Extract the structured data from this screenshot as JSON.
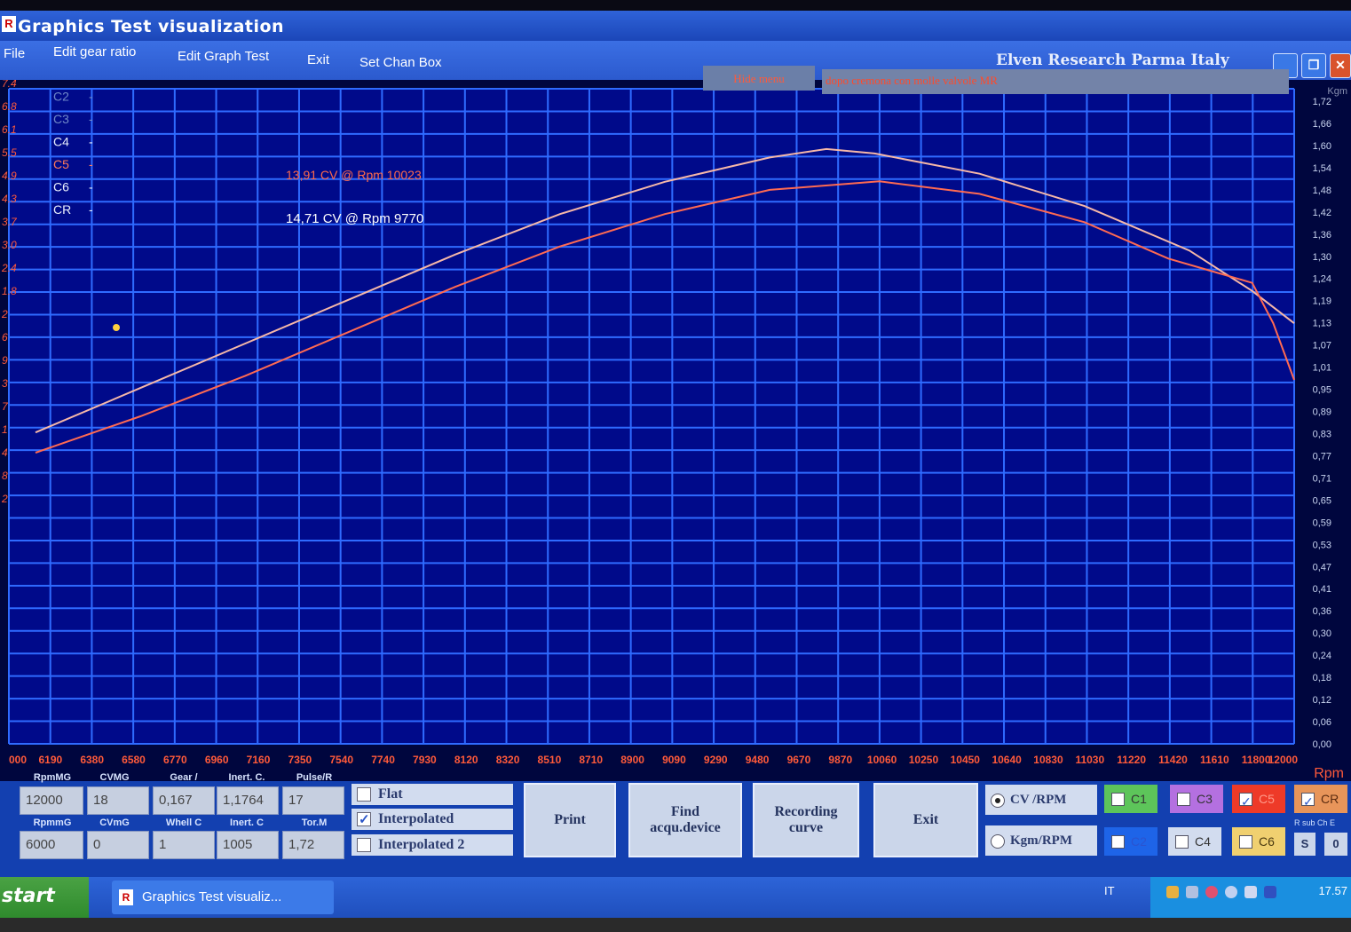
{
  "window": {
    "title": "Graphics Test visualization"
  },
  "menu": {
    "items": [
      "File",
      "Edit gear ratio",
      "Edit Graph Test",
      "Exit",
      "Set Chan Box"
    ],
    "brand": "Elven Research Parma Italy",
    "hide_menu": "Hide menu",
    "notes": "dopo cremona con molle valvole MR"
  },
  "colors": {
    "background": "#000a8a",
    "grid": "#2f6bff",
    "curve_light": "#f6b8a8",
    "curve_dark": "#ff6a52",
    "accent_red": "#ff5a3a"
  },
  "readout": {
    "channels": [
      "C1",
      "C2",
      "C3",
      "C4",
      "C5",
      "C6",
      "CR"
    ],
    "c5_value": "13,91 CV @ Rpm  10023",
    "cr_value": "14,71 CV @ Rpm  9770"
  },
  "chart_data": {
    "type": "line",
    "x_tick_labels": [
      "000",
      "6190",
      "6380",
      "6580",
      "6770",
      "6960",
      "7160",
      "7350",
      "7540",
      "7740",
      "7930",
      "8120",
      "8320",
      "8510",
      "8710",
      "8900",
      "9090",
      "9290",
      "9480",
      "9670",
      "9870",
      "10060",
      "10250",
      "10450",
      "10640",
      "10830",
      "11030",
      "11220",
      "11420",
      "11610",
      "11800",
      "12000"
    ],
    "right_tick_labels": [
      "1,72",
      "1,66",
      "1,60",
      "1,54",
      "1,48",
      "1,42",
      "1,36",
      "1,30",
      "1,24",
      "1,19",
      "1,13",
      "1,07",
      "1,01",
      "0,95",
      "0,89",
      "0,83",
      "0,77",
      "0,71",
      "0,65",
      "0,59",
      "0,53",
      "0,47",
      "0,41",
      "0,36",
      "0,30",
      "0,24",
      "0,18",
      "0,12",
      "0,06",
      "0,00"
    ],
    "right_axis_header": "Kgm",
    "left_tick_labels": [
      "7.4",
      "6.8",
      "6.1",
      "5.5",
      "4.9",
      "4.3",
      "3.7",
      "3.0",
      "2.4",
      "1.8",
      "2",
      "6",
      "9",
      "3",
      "7",
      "1",
      "4",
      "8",
      "2"
    ],
    "xlabel": "Rpm",
    "xlim": [
      6000,
      12000
    ],
    "ylim": [
      0,
      16.2
    ],
    "series": [
      {
        "name": "CR",
        "color": "#f6b8a8",
        "x": [
          6000,
          6500,
          7000,
          7500,
          8000,
          8500,
          9000,
          9500,
          9770,
          10000,
          10500,
          11000,
          11500,
          11800,
          12000
        ],
        "y": [
          7.7,
          8.8,
          9.9,
          11.0,
          12.1,
          13.1,
          13.9,
          14.5,
          14.71,
          14.6,
          14.1,
          13.3,
          12.2,
          11.2,
          10.4
        ]
      },
      {
        "name": "C5",
        "color": "#ff6a52",
        "x": [
          6000,
          6500,
          7000,
          7500,
          8000,
          8500,
          9000,
          9500,
          10023,
          10500,
          11000,
          11400,
          11600,
          11800,
          11900,
          12000
        ],
        "y": [
          7.2,
          8.1,
          9.1,
          10.2,
          11.3,
          12.3,
          13.1,
          13.7,
          13.91,
          13.6,
          12.9,
          12.0,
          11.7,
          11.4,
          10.4,
          9.0
        ]
      }
    ]
  },
  "params": {
    "row1": [
      {
        "label": "RpmMG",
        "value": "12000"
      },
      {
        "label": "CVMG",
        "value": "18"
      },
      {
        "label": "Gear /",
        "value": "0,167"
      },
      {
        "label": "Inert. C.",
        "value": "1,1764"
      },
      {
        "label": "Pulse/R",
        "value": "17"
      }
    ],
    "row2": [
      {
        "label": "RpmmG",
        "value": "6000"
      },
      {
        "label": "CVmG",
        "value": "0"
      },
      {
        "label": "Whell C",
        "value": "1"
      },
      {
        "label": "Inert. C",
        "value": "1005"
      },
      {
        "label": "Tor.M",
        "value": "1,72"
      }
    ]
  },
  "options": {
    "flat": "Flat",
    "interpolated": "Interpolated",
    "interpolated2": "Interpolated 2"
  },
  "buttons": {
    "print": "Print",
    "find_line1": "Find",
    "find_line2": "acqu.device",
    "recording_line1": "Recording",
    "recording_line2": "curve",
    "exit": "Exit"
  },
  "modes": {
    "cv_rpm": "CV /RPM",
    "kgm_rpm": "Kgm/RPM"
  },
  "channel_toggles": {
    "c1": "C1",
    "c2": "C2",
    "c3": "C3",
    "c4": "C4",
    "c5": "C5",
    "c6": "C6",
    "cr": "CR",
    "sub_label": "R sub Ch E",
    "s": "S",
    "o": "0"
  },
  "taskbar": {
    "start": "start",
    "task": "Graphics Test visualiz...",
    "lang": "IT",
    "clock": "17.57"
  }
}
